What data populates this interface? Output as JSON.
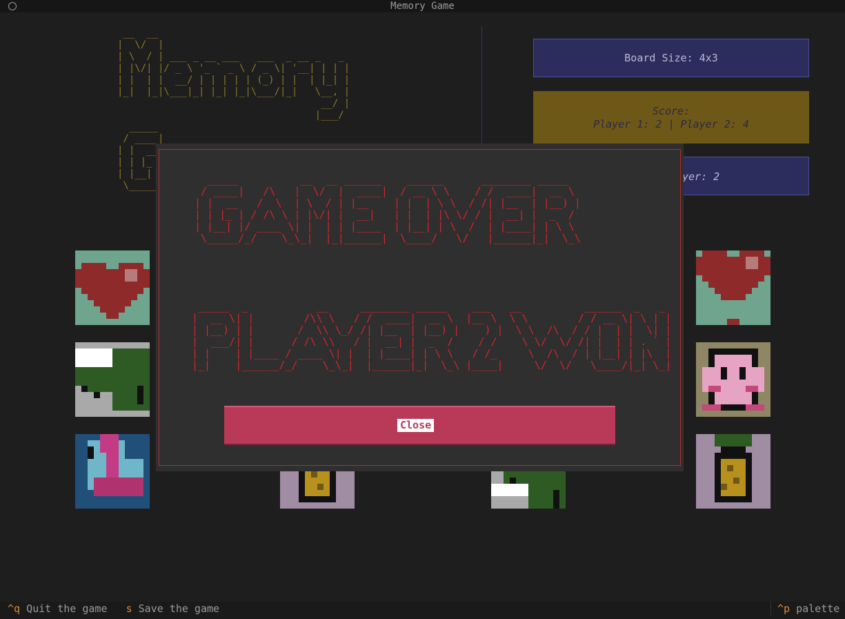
{
  "window": {
    "title": "Memory Game"
  },
  "logo": {
    "ascii": " __  __\n|  \\/  |\n| \\  / | ___ _ __ ___   ___  _ __ _   _\n| |\\/| |/ _ \\ '_ ` _ \\ / _ \\| '__| | | |\n| |  | |  __/ | | | | | (_) | |  | |_| |\n|_|  |_|\\___|_| |_| |_|\\___/|_|   \\__, |\n                                   __/ |\n                                  |___/\n  _____\n / ____|\n| |  __\n| | |_ |\n| |__| |\n \\_____|"
  },
  "board": {
    "label": "Board Size: 4x3"
  },
  "score": {
    "label": "Score:",
    "line": "Player 1: 2 | Player 2: 4"
  },
  "turn": {
    "label": "yer: 2"
  },
  "modal": {
    "game_over_ascii": "  _____          __  __ ______    ______      ________ _____\n / ____|   /\\   |  \\/  |  ____|  / __ \\ \\    / /  ____|  __ \\\n| |  __   /  \\  | \\  / | |__    | |  | \\ \\  / /| |__  | |__) |\n| | |_ | / /\\ \\ | |\\/| |  __|   | |  | |\\ \\/ / |  __| |  _  /\n| |__| |/ ____ \\| |  | | |____  | |__| | \\  /  | |____| | \\ \\\n \\_____/_/    \\_\\_|  |_|______|  \\____/   \\/   |______|_|  \\_\\",
    "winner_ascii": " _____  _           __     ________ _____    ___   __          ______  _   _\n|  __ \\| |        /\\\\ \\   / /  ____|  __ \\  |__ \\  \\ \\        / / __ \\| \\ | |\n| |__) | |       /  \\\\ \\_/ /| |__  | |__) |    ) |  \\ \\  /\\  / / |  | |  \\| |\n|  ___/| |      / /\\ \\\\   / |  __| |  _  /    / /    \\ \\/  \\/ /| |  | | . ` |\n| |    | |____ / ____ \\| |  | |____| | \\ \\   / /_     \\  /\\  / | |__| | |\\  |\n|_|    |______/_/    \\_\\_|  |______|_|  \\_\\ |____|     \\/  \\/   \\____/|_| \\_|",
    "close_label": "Close"
  },
  "cards": [
    {
      "name": "heart-card",
      "icon": "heart-icon"
    },
    {
      "name": "heart-card",
      "icon": "heart-icon"
    },
    {
      "name": "crocodile-card",
      "icon": "crocodile-icon"
    },
    {
      "name": "kirby-card",
      "icon": "kirby-icon"
    },
    {
      "name": "flamingo-card",
      "icon": "flamingo-icon"
    },
    {
      "name": "pineapple-card",
      "icon": "pineapple-icon"
    },
    {
      "name": "pineapple-card",
      "icon": "pineapple-icon"
    },
    {
      "name": "crocodile-card",
      "icon": "crocodile-icon"
    }
  ],
  "footer": {
    "quit_key": "^q",
    "quit_label": "Quit the game",
    "save_key": "s",
    "save_label": "Save the game",
    "palette_key": "^p",
    "palette_label": "palette"
  },
  "colors": {
    "accent_gold": "#8b7a23",
    "danger_red": "#d1262b",
    "close_pink": "#b83a58",
    "panel_blue": "#2c2d5c"
  }
}
